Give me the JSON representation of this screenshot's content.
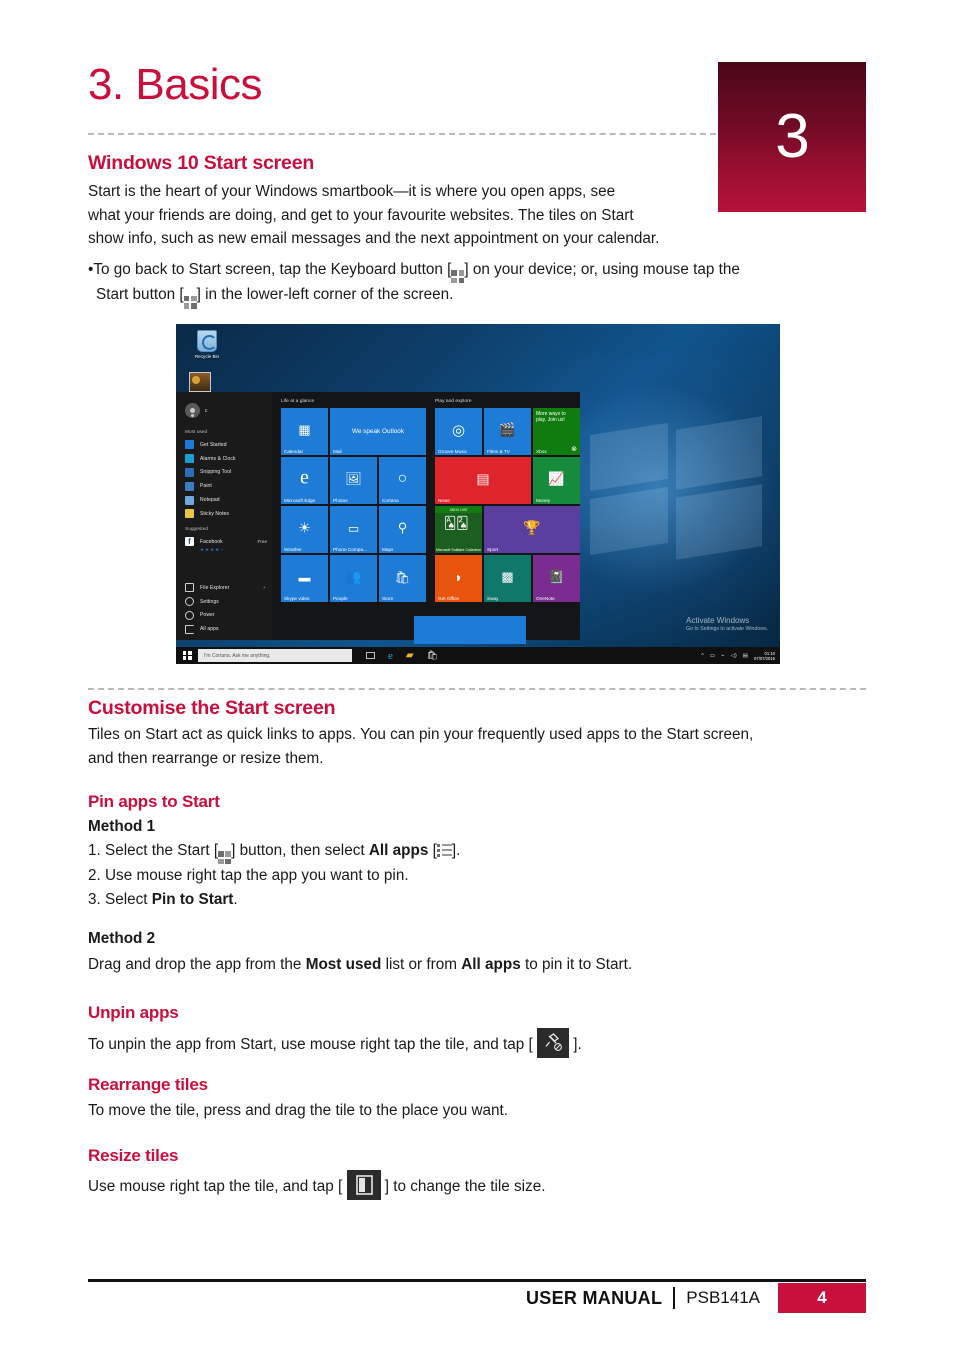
{
  "chapter": {
    "number": "3",
    "title": "3. Basics"
  },
  "sections": {
    "start_screen": {
      "heading": "Windows 10 Start screen",
      "para_line1": "Start is the heart of your Windows smartbook—it is where you open apps, see",
      "para_line2": "what your friends are doing, and get to your favourite websites. The tiles on Start",
      "para_line3": "show info,  such as new email messages and the next appointment on your calendar.",
      "bullet_a": "•To go back to Start screen, tap the Keyboard button [",
      "bullet_b": "] on your device; or, using mouse tap the",
      "bullet_c": "Start button [",
      "bullet_d": "] in the lower-left corner of the screen."
    },
    "customise": {
      "heading": "Customise the Start screen",
      "para_line1": "Tiles on Start act as quick links to apps. You can pin your frequently used apps to the Start screen,",
      "para_line2": "and then rearrange or resize them."
    },
    "pin_apps": {
      "heading": "Pin apps to Start",
      "method1_label": "Method 1",
      "step1_a": "1. Select the Start [",
      "step1_b": "] button, then select ",
      "step1_bold": "All apps",
      "step1_c": " [",
      "step1_d": "].",
      "step2": "2. Use mouse right tap the app you want to pin.",
      "step3_a": "3. Select ",
      "step3_bold": "Pin to Start",
      "step3_b": ".",
      "method2_label": "Method 2",
      "method2_a": "Drag and drop the app from the ",
      "method2_bold1": "Most used",
      "method2_b": " list or from ",
      "method2_bold2": "All apps",
      "method2_c": " to pin it to Start."
    },
    "unpin": {
      "heading": "Unpin apps",
      "text_a": "To unpin the app from Start, use mouse right tap  the tile, and tap [",
      "text_b": "]."
    },
    "rearrange": {
      "heading": "Rearrange tiles",
      "text": "To move the tile, press and drag the tile to the place you want."
    },
    "resize": {
      "heading": "Resize tiles",
      "text_a": "Use mouse right tap the tile, and tap [",
      "text_b": "] to change the tile size."
    }
  },
  "screenshot": {
    "desktop": {
      "recycle_bin_label": "Recycle Bin"
    },
    "start_menu": {
      "account_name": "c",
      "most_used_header": "Most used",
      "most_used": [
        "Get Started",
        "Alarms & Clock",
        "Snipping Tool",
        "Paint",
        "Notepad",
        "Sticky Notes"
      ],
      "suggested_header": "Suggested",
      "suggested_app": "Facebook",
      "suggested_price": "Free",
      "suggested_rating": "★★★★☆",
      "bottom_items": [
        "File Explorer",
        "Settings",
        "Power",
        "All apps"
      ],
      "groups": [
        {
          "title": "Life at a glance",
          "tiles": [
            {
              "name": "Calendar",
              "color": "blue",
              "size": "small",
              "icon": "calendar-icon"
            },
            {
              "name": "Mail",
              "color": "blue",
              "size": "wide",
              "icon": "mail-icon",
              "caption": "We speak Outlook"
            },
            {
              "name": "Microsoft Edge",
              "color": "blue",
              "size": "small",
              "icon": "edge-icon"
            },
            {
              "name": "Photos",
              "color": "blue",
              "size": "small",
              "icon": "photos-icon"
            },
            {
              "name": "Cortana",
              "color": "blue",
              "size": "small",
              "icon": "cortana-icon"
            },
            {
              "name": "Weather",
              "color": "blue",
              "size": "small",
              "icon": "weather-icon"
            },
            {
              "name": "Phone Compa...",
              "color": "blue",
              "size": "small",
              "icon": "phone-companion-icon"
            },
            {
              "name": "Maps",
              "color": "blue",
              "size": "small",
              "icon": "maps-icon"
            },
            {
              "name": "Skype video",
              "color": "blue",
              "size": "small",
              "icon": "skype-video-icon"
            },
            {
              "name": "People",
              "color": "blue",
              "size": "small",
              "icon": "people-icon"
            },
            {
              "name": "Store",
              "color": "blue",
              "size": "small",
              "icon": "store-icon"
            }
          ]
        },
        {
          "title": "Play and explore",
          "tiles": [
            {
              "name": "Groove Music",
              "color": "blue",
              "size": "small",
              "icon": "groove-music-icon"
            },
            {
              "name": "Films & TV",
              "color": "blue",
              "size": "small",
              "icon": "films-tv-icon"
            },
            {
              "name": "Xbox",
              "color": "green",
              "size": "small",
              "icon": "xbox-icon",
              "caption": "More ways to play. Join us!"
            },
            {
              "name": "News",
              "color": "red",
              "size": "wide",
              "icon": "news-icon"
            },
            {
              "name": "Money",
              "color": "green2",
              "size": "small",
              "icon": "money-icon"
            },
            {
              "name": "Microsoft Solitaire Collection",
              "color": "solitaire",
              "size": "small",
              "icon": "solitaire-icon",
              "badge": "XBOX LIVE"
            },
            {
              "name": "Sport",
              "color": "purple",
              "size": "wide",
              "icon": "trophy-icon"
            },
            {
              "name": "Get Office",
              "color": "orange",
              "size": "small",
              "icon": "office-icon"
            },
            {
              "name": "Sway",
              "color": "teal",
              "size": "small",
              "icon": "sway-icon"
            },
            {
              "name": "OneNote",
              "color": "violet",
              "size": "small",
              "icon": "onenote-icon"
            }
          ]
        }
      ]
    },
    "taskbar": {
      "search_placeholder": "I'm Cortana. Ask me anything.",
      "icons": [
        "task-view-icon",
        "edge-icon",
        "file-explorer-icon",
        "store-icon"
      ],
      "clock_time": "01:10",
      "clock_date": "07/07/2016"
    },
    "watermark": {
      "line1": "Activate Windows",
      "line2": "Go to Settings to activate Windows."
    }
  },
  "footer": {
    "manual_label": "USER MANUAL",
    "model": "PSB141A",
    "page_number": "4"
  },
  "colors": {
    "accent": "#c8103c",
    "chapter_gradient_top": "#4a0718",
    "chapter_gradient_bottom": "#b61239",
    "tile_blue": "#1e7bd6"
  }
}
